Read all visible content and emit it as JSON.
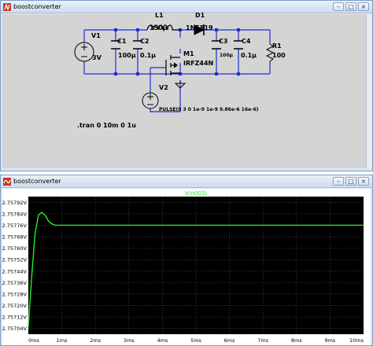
{
  "schematic_window": {
    "title": "boostconverter",
    "controls": {
      "minimize": "–",
      "maximize": "□",
      "close": "×"
    }
  },
  "schematic": {
    "components": {
      "V1": {
        "name": "V1",
        "value": "3V"
      },
      "C1": {
        "name": "C1",
        "value": "100μ"
      },
      "C2": {
        "name": "C2",
        "value": "0.1μ"
      },
      "L1": {
        "name": "L1",
        "value": "150μ"
      },
      "D1": {
        "name": "D1",
        "value": "1N5819"
      },
      "C3": {
        "name": "C3",
        "value": "100μ"
      },
      "C4": {
        "name": "C4",
        "value": "0.1μ"
      },
      "R1": {
        "name": "R1",
        "value": "100"
      },
      "M1": {
        "name": "M1",
        "value": "IRFZ44N"
      },
      "V2": {
        "name": "V2",
        "value": "PULSE(0 3 0 1e-9 1e-9 9.86e-6 16e-6)"
      }
    },
    "directive": ".tran 0 10m 0 1u"
  },
  "waveform_window": {
    "title": "boostconverter",
    "controls": {
      "minimize": "–",
      "maximize": "□",
      "close": "×"
    }
  },
  "colors": {
    "trace": "#22ee22",
    "plot_bg": "#000000",
    "grid": "#5a5a5a",
    "wire": "#1f2fd0",
    "component": "#000000"
  },
  "chart_data": {
    "type": "line",
    "title": "V(n003)",
    "series": [
      {
        "name": "V(n003)",
        "x": [
          "0ms",
          "0.1ms",
          "0.2ms",
          "0.3ms",
          "0.4ms",
          "0.5ms",
          "0.6ms",
          "0.7ms",
          "0.8ms",
          "1.0ms",
          "1.5ms",
          "2ms",
          "3ms",
          "4ms",
          "5ms",
          "6ms",
          "7ms",
          "8ms",
          "9ms",
          "10ms"
        ],
        "x_ms": [
          0,
          0.1,
          0.2,
          0.3,
          0.4,
          0.5,
          0.6,
          0.7,
          0.8,
          1.0,
          1.5,
          2,
          3,
          4,
          5,
          6,
          7,
          8,
          9,
          10
        ],
        "y": [
          2.75705,
          2.7574,
          2.7577,
          2.75783,
          2.75785,
          2.75783,
          2.75779,
          2.75777,
          2.75776,
          2.75776,
          2.75776,
          2.75776,
          2.75776,
          2.75776,
          2.75776,
          2.75776,
          2.75776,
          2.75776,
          2.75776,
          2.75776
        ]
      }
    ],
    "x_ticks": [
      "0ms",
      "1ms",
      "2ms",
      "3ms",
      "4ms",
      "5ms",
      "6ms",
      "7ms",
      "8ms",
      "9ms",
      "10ms"
    ],
    "y_ticks": [
      "2.75792V",
      "2.75784V",
      "2.75776V",
      "2.75768V",
      "2.75760V",
      "2.75752V",
      "2.75744V",
      "2.75736V",
      "2.75728V",
      "2.75720V",
      "2.75712V",
      "2.75704V"
    ],
    "xlim": [
      0,
      10
    ],
    "ylim": [
      2.757,
      2.75796
    ],
    "grid": true
  }
}
